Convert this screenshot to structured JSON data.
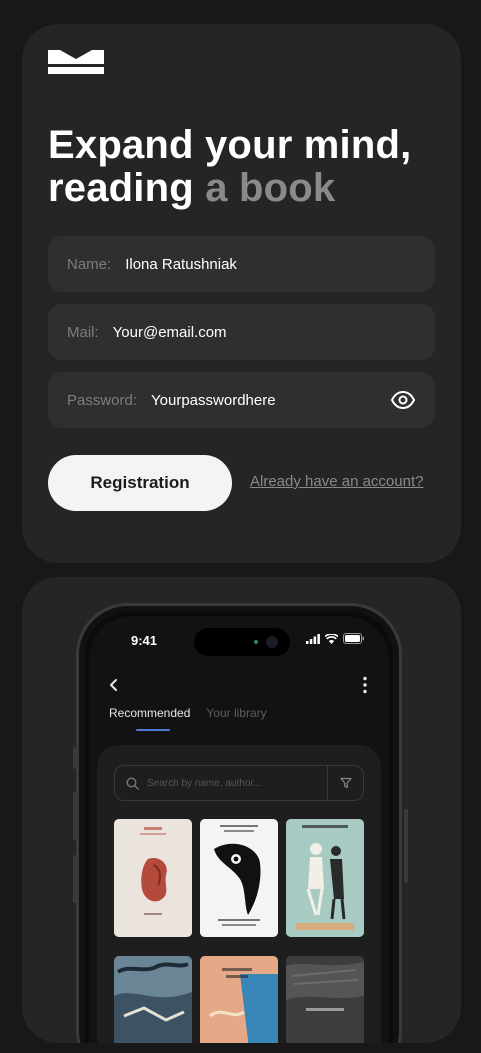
{
  "headline": {
    "line1": "Expand your mind,",
    "line2_strong": "reading",
    "line2_muted": "a book"
  },
  "form": {
    "name": {
      "label": "Name:",
      "value": "Ilona Ratushniak"
    },
    "mail": {
      "label": "Mail:",
      "value": "Your@email.com"
    },
    "password": {
      "label": "Password:",
      "value": "Yourpasswordhere"
    },
    "register_label": "Registration",
    "login_link": "Already have an account?"
  },
  "phone": {
    "time": "9:41",
    "tabs": [
      {
        "label": "Recommended",
        "active": true
      },
      {
        "label": "Your library",
        "active": false
      }
    ],
    "search_placeholder": "Search by name, author..."
  },
  "colors": {
    "background": "#181818",
    "card": "#252525",
    "field": "#2f2f2f",
    "accent": "#4e7bd6",
    "button": "#f4f4f4"
  }
}
